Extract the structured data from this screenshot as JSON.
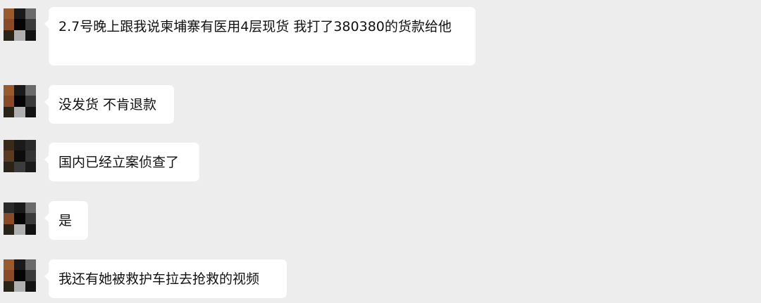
{
  "messages": [
    {
      "text": "2.7号晚上跟我说柬埔寨有医用4层现货 我打了380380的货款给他"
    },
    {
      "text": "没发货 不肯退款"
    },
    {
      "text": "国内已经立案侦查了"
    },
    {
      "text": "是"
    },
    {
      "text": "我还有她被救护车拉去抢救的视频"
    }
  ],
  "colors": {
    "background": "#ededed",
    "bubble": "#ffffff",
    "text": "#111111"
  }
}
